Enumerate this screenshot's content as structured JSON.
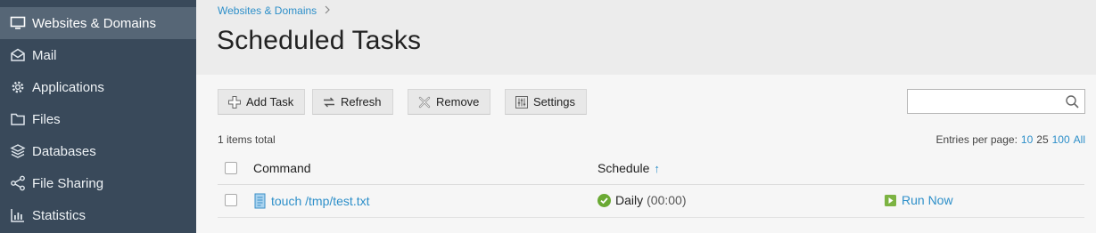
{
  "sidebar": {
    "items": [
      {
        "label": "Websites & Domains",
        "icon": "monitor-icon",
        "active": true
      },
      {
        "label": "Mail",
        "icon": "mail-icon",
        "active": false
      },
      {
        "label": "Applications",
        "icon": "gear-icon",
        "active": false
      },
      {
        "label": "Files",
        "icon": "folder-icon",
        "active": false
      },
      {
        "label": "Databases",
        "icon": "database-icon",
        "active": false
      },
      {
        "label": "File Sharing",
        "icon": "share-icon",
        "active": false
      },
      {
        "label": "Statistics",
        "icon": "bar-chart-icon",
        "active": false
      }
    ]
  },
  "header": {
    "breadcrumb": "Websites & Domains",
    "breadcrumb_separator": ">",
    "title": "Scheduled Tasks"
  },
  "toolbar": {
    "add_task": "Add Task",
    "refresh": "Refresh",
    "remove": "Remove",
    "settings": "Settings",
    "search_value": ""
  },
  "list": {
    "total": "1 items total",
    "entries_label": "Entries per page:",
    "page_sizes": [
      "10",
      "25",
      "100",
      "All"
    ],
    "current_page_size": "25",
    "columns": {
      "command": "Command",
      "schedule": "Schedule",
      "sort_indicator": "↑"
    },
    "rows": [
      {
        "command": "touch /tmp/test.txt",
        "schedule": "Daily",
        "time": "(00:00)",
        "action": "Run Now"
      }
    ]
  },
  "colors": {
    "sidebar_bg": "#39495a",
    "sidebar_active": "#566676",
    "link": "#2d8fc9",
    "status_ok": "#6aa933",
    "run_icon": "#7cb342"
  }
}
